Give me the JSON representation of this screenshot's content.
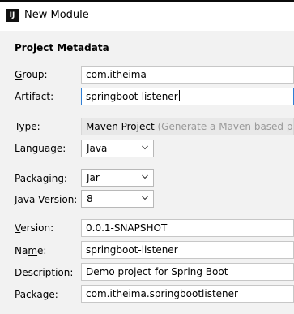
{
  "window": {
    "title": "New Module",
    "app_icon_text": "IJ"
  },
  "section_title": "Project Metadata",
  "fields": {
    "group": {
      "label_pre": "",
      "label_ul": "G",
      "label_post": "roup:",
      "value": "com.itheima"
    },
    "artifact": {
      "label_pre": "",
      "label_ul": "A",
      "label_post": "rtifact:",
      "value": "springboot-listener"
    },
    "type": {
      "label_pre": "",
      "label_ul": "T",
      "label_post": "ype:",
      "value": "Maven Project",
      "hint": "(Generate a Maven based pro"
    },
    "language": {
      "label_pre": "",
      "label_ul": "L",
      "label_post": "anguage:",
      "value": "Java"
    },
    "packaging": {
      "label_pre": "Packa",
      "label_ul": "g",
      "label_post": "ing:",
      "value": "Jar"
    },
    "java_version": {
      "label_pre": "",
      "label_ul": "J",
      "label_post": "ava Version:",
      "value": "8"
    },
    "version": {
      "label_pre": "",
      "label_ul": "V",
      "label_post": "ersion:",
      "value": "0.0.1-SNAPSHOT"
    },
    "name": {
      "label_pre": "Na",
      "label_ul": "m",
      "label_post": "e:",
      "value": "springboot-listener"
    },
    "description": {
      "label_pre": "",
      "label_ul": "D",
      "label_post": "escription:",
      "value": "Demo project for Spring Boot"
    },
    "package": {
      "label_pre": "Pac",
      "label_ul": "k",
      "label_post": "age:",
      "value": "com.itheima.springbootlistener"
    }
  }
}
